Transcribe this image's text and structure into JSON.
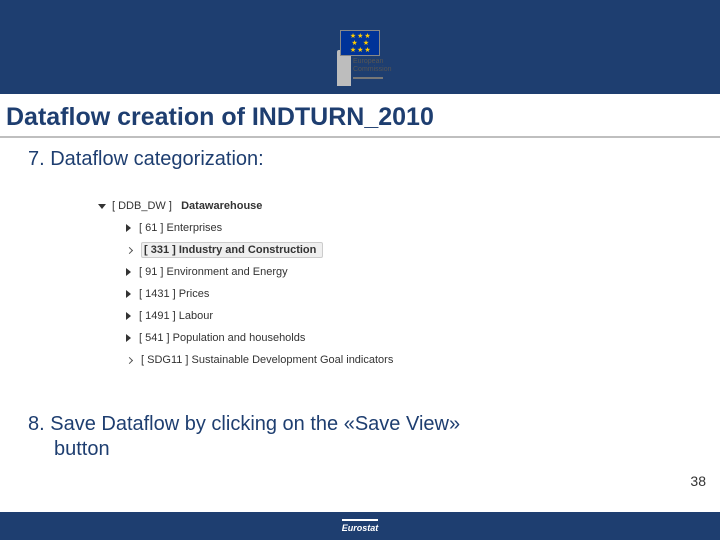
{
  "logo": {
    "line1": "European",
    "line2": "Commission"
  },
  "title": "Dataflow creation of INDTURN_2010",
  "step7": "7. Dataflow categorization:",
  "tree": {
    "root": {
      "code": "[ DDB_DW ]",
      "label": "Datawarehouse"
    },
    "items": [
      {
        "code": "[ 61 ]",
        "label": "Enterprises",
        "solid": true,
        "highlighted": false,
        "bold": false
      },
      {
        "code": "[ 331 ]",
        "label": "Industry and Construction",
        "solid": false,
        "highlighted": true,
        "bold": true
      },
      {
        "code": "[ 91 ]",
        "label": "Environment and Energy",
        "solid": true,
        "highlighted": false,
        "bold": false
      },
      {
        "code": "[ 1431 ]",
        "label": "Prices",
        "solid": true,
        "highlighted": false,
        "bold": false
      },
      {
        "code": "[ 1491 ]",
        "label": "Labour",
        "solid": true,
        "highlighted": false,
        "bold": false
      },
      {
        "code": "[ 541 ]",
        "label": "Population and households",
        "solid": true,
        "highlighted": false,
        "bold": false
      },
      {
        "code": "[ SDG11 ]",
        "label": "Sustainable Development Goal indicators",
        "solid": false,
        "highlighted": false,
        "bold": false
      }
    ]
  },
  "step8_line1": "8. Save Dataflow by clicking on the «Save View»",
  "step8_line2": "button",
  "page_number": "38",
  "footer": "Eurostat"
}
